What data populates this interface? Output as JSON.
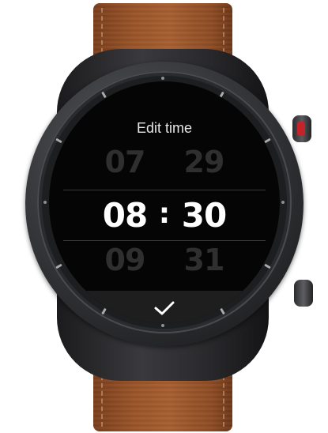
{
  "screen": {
    "title": "Edit time",
    "hours": {
      "previous": "07",
      "selected": "08",
      "next": "09"
    },
    "minutes": {
      "previous": "29",
      "selected": "30",
      "next": "31"
    },
    "separator": ":"
  },
  "icons": {
    "confirm": "checkmark-icon"
  },
  "colors": {
    "strap": "#9a5529",
    "crown_accent": "#c4232a",
    "screen_bg": "#050505",
    "text": "#ffffff"
  }
}
